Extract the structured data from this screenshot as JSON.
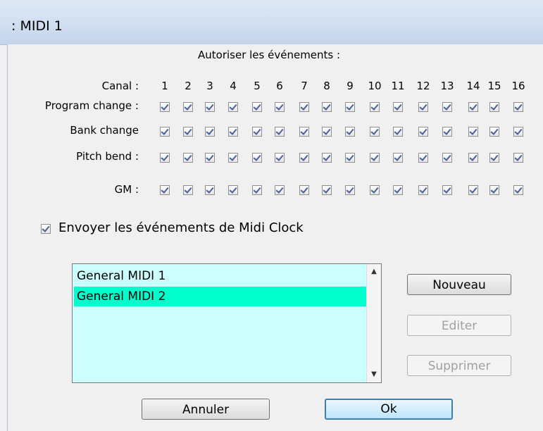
{
  "window": {
    "title": ": MIDI 1"
  },
  "filters": {
    "header": "Autoriser les événements :",
    "channel_label": "Canal :",
    "channels": [
      "1",
      "2",
      "3",
      "4",
      "5",
      "6",
      "7",
      "8",
      "9",
      "10",
      "11",
      "12",
      "13",
      "14",
      "15",
      "16"
    ],
    "rows": [
      {
        "label": "Program change :",
        "checked": true
      },
      {
        "label": "Bank change",
        "checked": true
      },
      {
        "label": "Pitch bend :",
        "checked": true
      },
      {
        "label": "GM :",
        "checked": true
      }
    ]
  },
  "midi_clock": {
    "label": "Envoyer les événements de Midi Clock",
    "checked": true
  },
  "list": {
    "items": [
      "General MIDI 1",
      "General MIDI 2"
    ],
    "selected_index": 1
  },
  "buttons": {
    "new": "Nouveau",
    "edit": "Editer",
    "delete": "Supprimer",
    "cancel": "Annuler",
    "ok": "Ok"
  },
  "colors": {
    "list_background": "#ccffff",
    "selection": "#00ffcc",
    "checkmark": "#4a5f9e"
  }
}
